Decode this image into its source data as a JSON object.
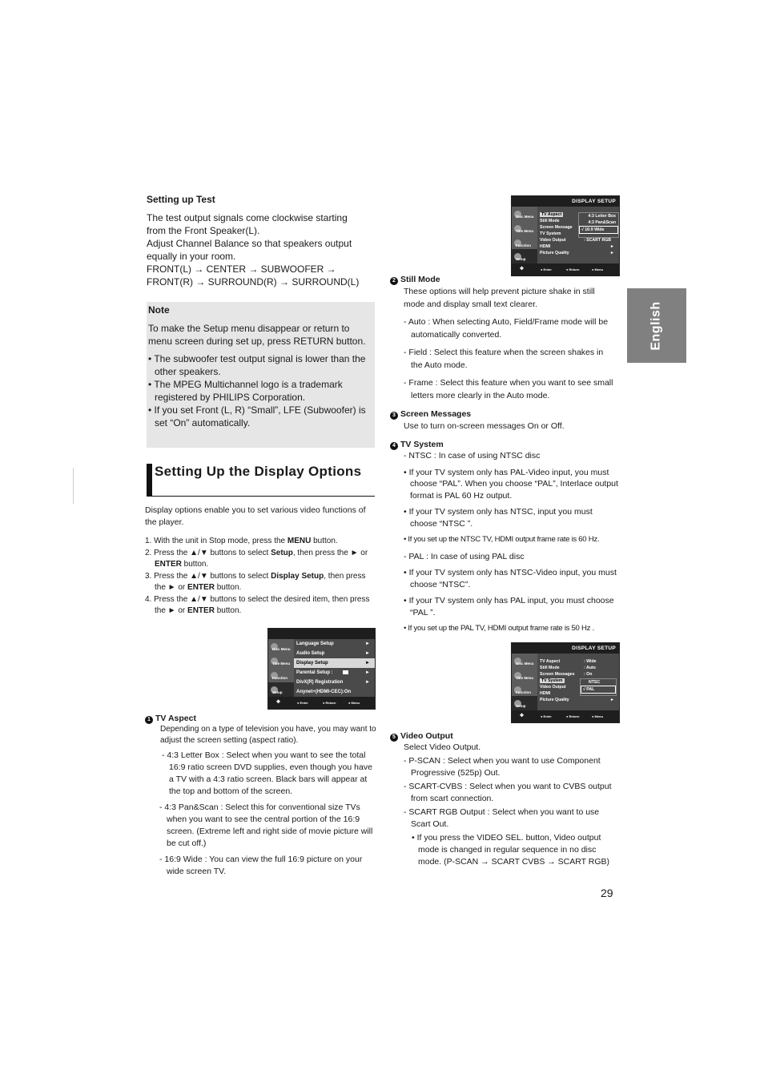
{
  "setting_up_test": {
    "title": "Setting up Test",
    "lines": [
      "The test output signals come clockwise starting",
      "from the Front Speaker(L).",
      "Adjust Channel Balance so that speakers output",
      "equally in your room.",
      "FRONT(L) → CENTER → SUBWOOFER →",
      "FRONT(R) → SURROUND(R) → SURROUND(L)"
    ]
  },
  "note": {
    "title": "Note",
    "intro": "To make the Setup menu disappear or return to menu screen during set up, press RETURN button.",
    "bullets": [
      "• The subwoofer test output signal is lower than the other speakers.",
      "• The MPEG Multichannel logo is a trademark registered by PHILIPS Corporation.",
      "• If you set Front (L, R) “Small”, LFE (Subwoofer) is set “On” automatically."
    ]
  },
  "section": {
    "title": "Setting Up the Display Options",
    "intro": "Display options enable you to set various video functions of the player.",
    "steps": [
      {
        "pre": "1. With the unit in Stop mode, press the ",
        "bold": "MENU",
        "post": " button.",
        "bold2": "",
        "post2": ""
      },
      {
        "pre": "2. Press the ▲/▼ buttons to select ",
        "bold": "Setup",
        "post": ", then press the ► or ",
        "bold2": "ENTER",
        "post2": " button."
      },
      {
        "pre": "3. Press the ▲/▼ buttons to select ",
        "bold": "Display Setup",
        "post": ", then press the ► or ",
        "bold2": "ENTER",
        "post2": " button."
      },
      {
        "pre": "4. Press the ▲/▼ buttons to select the desired item, then press the ► or ",
        "bold": "ENTER",
        "post": " button.",
        "bold2": "",
        "post2": ""
      }
    ]
  },
  "osd_setup": {
    "side": [
      "Disc Menu",
      "Title Menu",
      "Function",
      "Setup"
    ],
    "rows": [
      {
        "label": "Language Setup",
        "arrow": "►"
      },
      {
        "label": "Audio Setup",
        "arrow": "►"
      },
      {
        "label": "Display Setup",
        "arrow": "►"
      },
      {
        "label": "Parental Setup :",
        "arrow": "►"
      },
      {
        "label": "DivX(R) Registration",
        "arrow": "►"
      },
      {
        "label": "Anynet+(HDMI-CEC):On",
        "arrow": ""
      }
    ],
    "selected_index": 2,
    "bottom": [
      "Enter",
      "Return",
      "Menu"
    ]
  },
  "osd_display_1": {
    "title": "DISPLAY SETUP",
    "side": [
      "Disc Menu",
      "Title Menu",
      "Function",
      "Setup"
    ],
    "rows": [
      {
        "label": "TV Aspect",
        "value": "",
        "arrow": ""
      },
      {
        "label": "Still Mode",
        "value": "",
        "arrow": ""
      },
      {
        "label": "Screen Message",
        "value": "",
        "arrow": ""
      },
      {
        "label": "TV System",
        "value": "",
        "arrow": ""
      },
      {
        "label": "Video Output",
        "value": ": SCART RGB",
        "arrow": ""
      },
      {
        "label": "HDMI",
        "value": "",
        "arrow": "►"
      },
      {
        "label": "Picture Quality",
        "value": "",
        "arrow": "►"
      }
    ],
    "selected_index": 0,
    "popup": [
      "4:3 Letter Box",
      "4:3 Pan&Scan",
      "√ 16:9 Wide"
    ],
    "popup_current": 2,
    "bottom": [
      "Enter",
      "Return",
      "Menu"
    ]
  },
  "osd_display_2": {
    "title": "DISPLAY SETUP",
    "side": [
      "Disc Menu",
      "Title Menu",
      "Function",
      "Setup"
    ],
    "rows": [
      {
        "label": "TV Aspect",
        "value": ": Wide",
        "arrow": ""
      },
      {
        "label": "Still Mode",
        "value": ": Auto",
        "arrow": ""
      },
      {
        "label": "Screen Messages",
        "value": ": On",
        "arrow": ""
      },
      {
        "label": "TV System",
        "value": "",
        "arrow": ""
      },
      {
        "label": "Video Output",
        "value": "",
        "arrow": ""
      },
      {
        "label": "HDMI",
        "value": "",
        "arrow": "►"
      },
      {
        "label": "Picture Quality",
        "value": "",
        "arrow": "►"
      }
    ],
    "selected_index": 3,
    "popup": [
      "NTSC",
      "√ PAL"
    ],
    "popup_current": 1,
    "bottom": [
      "Enter",
      "Return",
      "Menu"
    ]
  },
  "tv_aspect": {
    "num": "1",
    "title": "TV Aspect",
    "intro": "Depending on a type of television you have, you may want to adjust the screen setting (aspect ratio).",
    "items": [
      "- 4:3 Letter Box : Select when you want to see the total 16:9 ratio screen DVD supplies, even though you have a TV with a 4:3 ratio screen. Black bars will appear at the top and bottom of the screen.",
      "- 4:3 Pan&Scan : Select this for conventional size TVs when you want to see the central portion of the 16:9 screen. (Extreme left and right side of movie picture will be cut off.)",
      "- 16:9 Wide : You can view the full 16:9 picture on your wide screen TV."
    ]
  },
  "still_mode": {
    "num": "2",
    "title": "Still Mode",
    "intro": "These options will help prevent picture shake in still mode and display small text clearer.",
    "items": [
      "- Auto : When selecting Auto, Field/Frame mode will be automatically converted.",
      "- Field : Select this feature when the screen shakes in the Auto mode.",
      "- Frame : Select this feature when you want to see small letters more clearly in the Auto mode."
    ]
  },
  "screen_messages": {
    "num": "3",
    "title": "Screen Messages",
    "intro": "Use to turn on-screen messages On or Off."
  },
  "tv_system": {
    "num": "4",
    "title": "TV System",
    "items": [
      "- NTSC : In case of using NTSC disc",
      "• If your TV system only has PAL-Video input, you must choose “PAL”. When you choose “PAL”, Interlace output format is PAL 60 Hz output.",
      "• If your TV system only has NTSC, input you must choose “NTSC ”.",
      "• If you set up the NTSC TV, HDMI output frame rate is 60 Hz.",
      "- PAL : In case of using PAL disc",
      "• If your TV system only has NTSC-Video input, you must choose “NTSC”.",
      "• If your TV system only has PAL input, you must choose “PAL ”.",
      "• If you set up the PAL TV, HDMI output frame rate is 50 Hz ."
    ]
  },
  "video_output": {
    "num": "5",
    "title": "Video Output",
    "intro": "Select Video Output.",
    "items": [
      "- P-SCAN : Select when you want to use Component Progressive (525p) Out.",
      "- SCART-CVBS : Select when you want to CVBS output from scart connection.",
      "- SCART RGB Output : Select when you want to use Scart Out."
    ],
    "bullet": "• If you press the VIDEO SEL. button, Video output mode is changed in regular sequence in no disc mode. (P-SCAN → SCART CVBS → SCART RGB)"
  },
  "language_tab": "English",
  "page_number": "29"
}
